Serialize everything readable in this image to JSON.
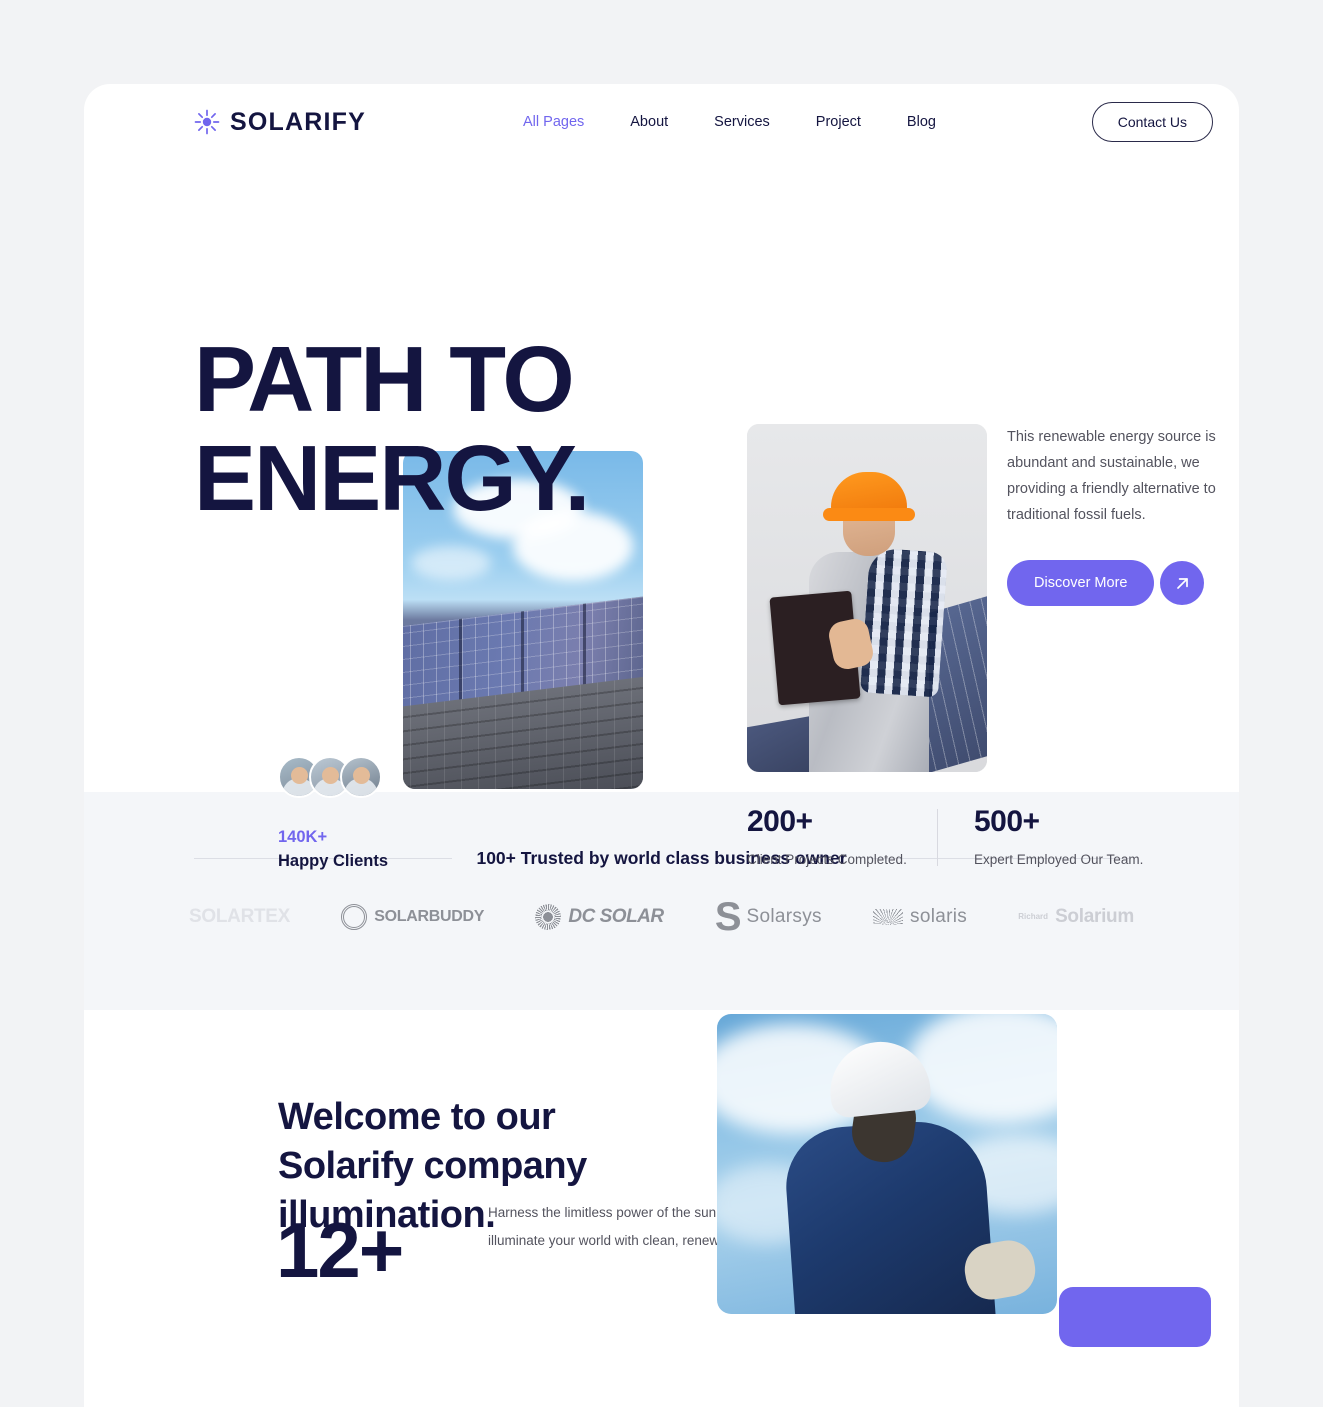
{
  "header": {
    "brand": "SOLARIFY",
    "logo_icon": "sun-icon",
    "nav": [
      {
        "label": "All Pages",
        "active": true
      },
      {
        "label": "About",
        "active": false
      },
      {
        "label": "Services",
        "active": false
      },
      {
        "label": "Project",
        "active": false
      },
      {
        "label": "Blog",
        "active": false
      }
    ],
    "contact_button": "Contact Us"
  },
  "hero": {
    "title_line1": "PATH TO",
    "title_line2": "ENERGY.",
    "description": "This renewable energy source is abundant and sustainable, we providing a friendly alternative to traditional fossil fuels.",
    "cta_label": "Discover More",
    "cta_arrow_icon": "arrow-up-right-icon",
    "clients_count": "140K+",
    "clients_label": "Happy Clients",
    "stats": [
      {
        "value": "200+",
        "label": "Client Projects Completed."
      },
      {
        "value": "500+",
        "label": "Expert Employed Our Team."
      }
    ],
    "images": {
      "solar_panel_roof": "solar-panels-on-roof-photo",
      "worker_clipboard": "worker-with-clipboard-photo"
    }
  },
  "partners": {
    "heading": "100+ Trusted by world class business owner",
    "logos": [
      {
        "name": "SOLARTEX",
        "style": "faint"
      },
      {
        "name": "SOLARBUDDY",
        "style": "normal"
      },
      {
        "name": "DC SOLAR",
        "style": "normal"
      },
      {
        "name": "Solarsys",
        "style": "normal"
      },
      {
        "name": "solaris",
        "style": "normal"
      },
      {
        "name": "Solarium",
        "sub": "Richard",
        "style": "faint2"
      }
    ]
  },
  "welcome": {
    "title": "Welcome to our Solarify company illumination.",
    "big_number": "12+",
    "description": "Harness the limitless power of the sun and illuminate your world with clean, renewable",
    "image": "worker-blue-jacket-sky-photo"
  },
  "colors": {
    "accent": "#7166ee",
    "dark": "#141540",
    "body_text": "#53535e",
    "page_bg": "#f2f3f5",
    "partners_bg": "#f4f6f9"
  }
}
